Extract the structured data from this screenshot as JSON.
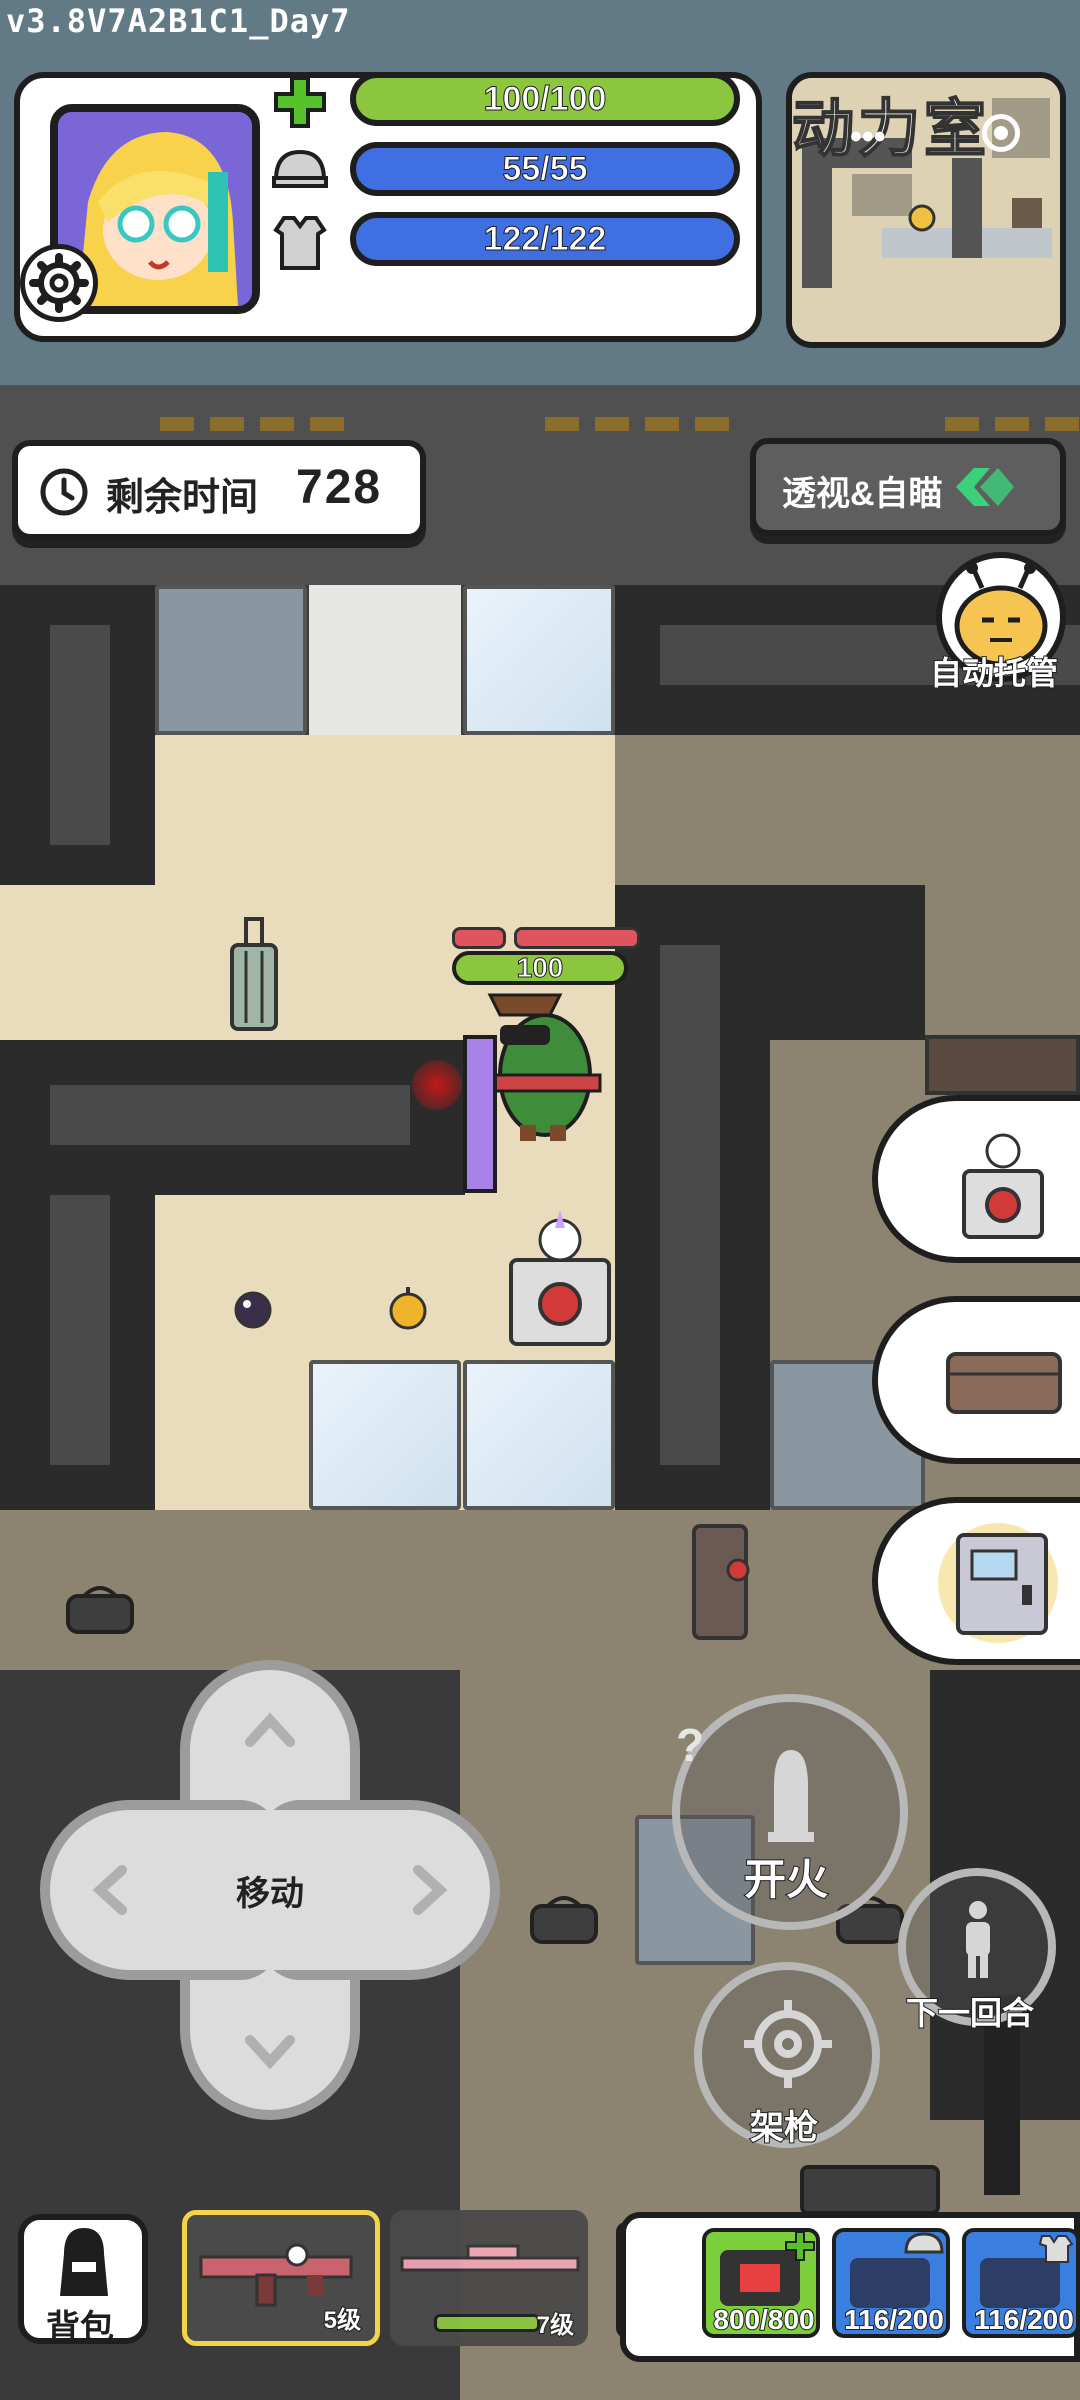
{
  "version": "v3.8V7A2B1C1_Day7",
  "stats": {
    "health": "100/100",
    "helmet": "55/55",
    "armor": "122/122",
    "health_color": "#8cc63f",
    "shield_color": "#3f6fe0"
  },
  "minimap": {
    "label": "动力室"
  },
  "timer": {
    "label": "剩余时间",
    "value": "728"
  },
  "xray_button": {
    "label": "透视&自瞄"
  },
  "auto_button": {
    "label": "自动托管"
  },
  "player": {
    "hp": "100"
  },
  "controls": {
    "move_label": "移动",
    "fire_label": "开火",
    "aim_label": "架枪",
    "next_round_label": "下一回合"
  },
  "inventory": {
    "bag_label": "背包",
    "weapons": [
      {
        "level": "5级"
      },
      {
        "level": "7级"
      }
    ],
    "items": [
      {
        "name": "medkit-icon",
        "count": "800/800"
      },
      {
        "name": "helmet-repair-icon",
        "count": "116/200"
      },
      {
        "name": "armor-repair-icon",
        "count": "116/200"
      }
    ]
  }
}
